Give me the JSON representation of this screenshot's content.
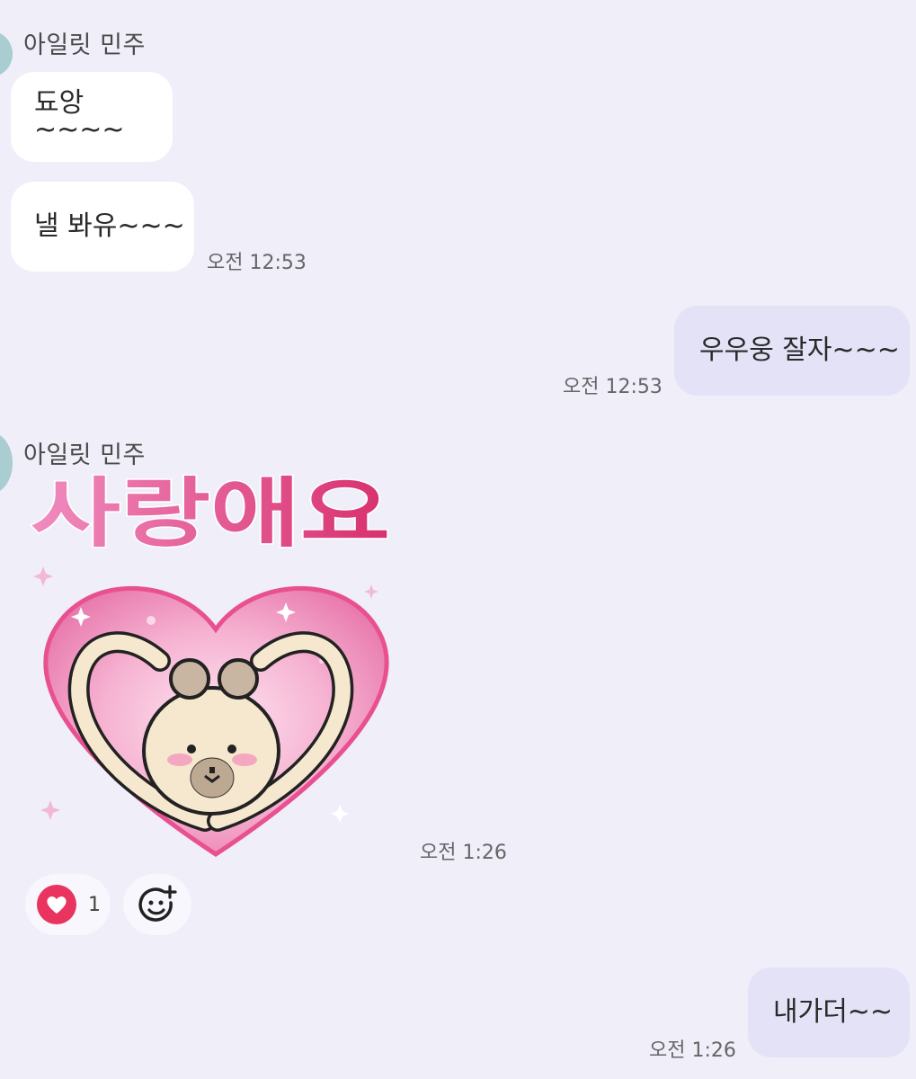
{
  "messages": [
    {
      "sender": "아일릿 민주",
      "text": "됴앙~~~~"
    },
    {
      "text": "낼 봐유~~~",
      "time": "오전 12:53"
    },
    {
      "text": "우우웅 잘자~~~",
      "time": "오전 12:53",
      "mine": true
    },
    {
      "sender": "아일릿 민주",
      "sticker_text": "사랑애요",
      "time": "오전 1:26"
    },
    {
      "text": "내가더~~",
      "time": "오전 1:26",
      "mine": true
    }
  ],
  "reactions": {
    "like_count": "1",
    "like_icon": "heart-icon",
    "add_icon": "add-emoji-icon"
  },
  "colors": {
    "background": "#efeef9",
    "incoming_bubble": "#ffffff",
    "outgoing_bubble": "#e4e2f7",
    "heart_red": "#e8345f",
    "sticker_pink": "#e0629c"
  }
}
